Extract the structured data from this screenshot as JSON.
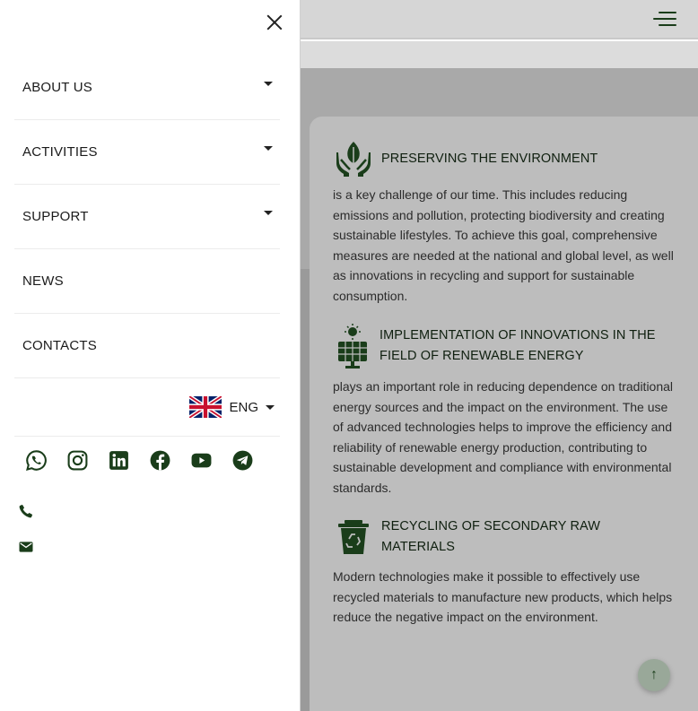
{
  "header": {
    "menu_icon": "hamburger-icon"
  },
  "drawer": {
    "close_icon": "close-icon",
    "menu": [
      {
        "label": "ABOUT US",
        "has_dropdown": true
      },
      {
        "label": "ACTIVITIES",
        "has_dropdown": true
      },
      {
        "label": "SUPPORT",
        "has_dropdown": true
      },
      {
        "label": "NEWS",
        "has_dropdown": false
      },
      {
        "label": "CONTACTS",
        "has_dropdown": false
      }
    ],
    "language": {
      "code": "ENG",
      "flag": "uk-flag-icon"
    },
    "socials": [
      "whatsapp-icon",
      "instagram-icon",
      "linkedin-icon",
      "facebook-icon",
      "youtube-icon",
      "telegram-icon"
    ],
    "contacts": [
      "phone-icon",
      "email-icon"
    ]
  },
  "content": {
    "blocks": [
      {
        "icon": "hands-leaf-icon",
        "title": "PRESERVING THE ENVIRONMENT",
        "text": "is a key challenge of our time. This includes reducing emissions and pollution, protecting biodiversity and creating sustainable lifestyles. To achieve this goal, comprehensive measures are needed at the national and global level, as well as innovations in recycling and support for sustainable consumption."
      },
      {
        "icon": "solar-panel-icon",
        "title": "IMPLEMENTATION OF INNOVATIONS IN THE FIELD OF RENEWABLE ENERGY",
        "text": "plays an important role in reducing dependence on traditional energy sources and the impact on the environment. The use of advanced technologies helps to improve the efficiency and reliability of renewable energy production, contributing to sustainable development and compliance with environmental standards."
      },
      {
        "icon": "recycle-bin-icon",
        "title": "RECYCLING OF SECONDARY RAW MATERIALS",
        "text": "Modern technologies make it possible to effectively use recycled materials to manufacture new products, which helps reduce the negative impact on the environment."
      }
    ]
  },
  "scroll_top_icon": "arrow-up-icon",
  "colors": {
    "brand_green": "#1a3d1a",
    "overlay_dim": "#a9a9a9"
  }
}
